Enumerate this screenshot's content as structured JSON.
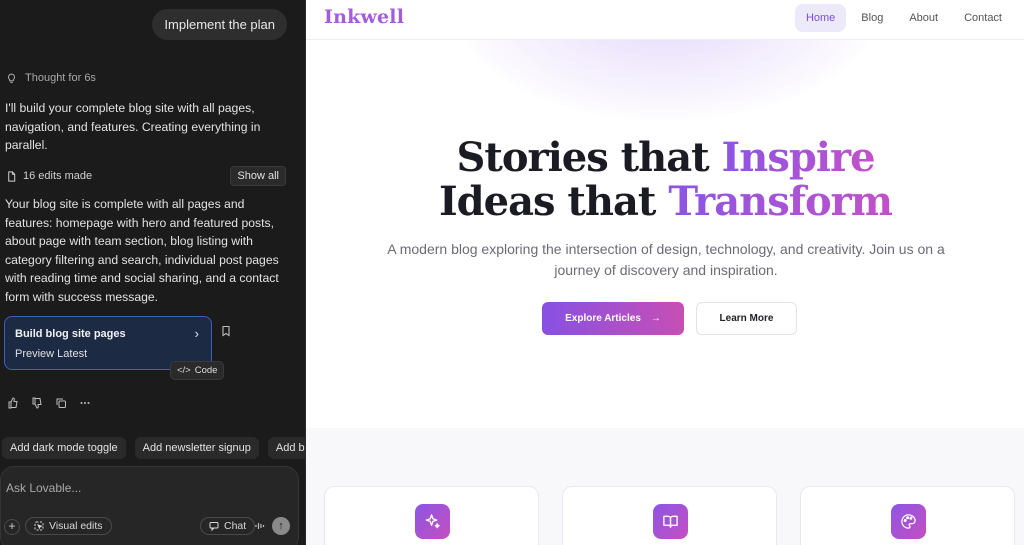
{
  "chat": {
    "user_message": "Implement the plan",
    "thought_label": "Thought for 6s",
    "intro_text": "I'll build your complete blog site with all pages, navigation, and features. Creating everything in parallel.",
    "edits_label": "16 edits made",
    "show_all_label": "Show all",
    "summary_text": "Your blog site is complete with all pages and features: homepage with hero and featured posts, about page with team section, blog listing with category filtering and search, individual post pages with reading time and social sharing, and a contact form with success message.",
    "version_card": {
      "title": "Build blog site pages",
      "subtitle": "Preview Latest",
      "chevron": "›"
    },
    "code_tooltip": "Code",
    "suggestions": [
      "Add dark mode toggle",
      "Add newsletter signup",
      "Add blog"
    ],
    "composer": {
      "placeholder": "Ask Lovable...",
      "plus_label": "+",
      "visual_edits_label": "Visual edits",
      "chat_label": "Chat",
      "send_label": "↑"
    }
  },
  "preview": {
    "logo": "Inkwell",
    "nav": [
      "Home",
      "Blog",
      "About",
      "Contact"
    ],
    "active_nav": "Home",
    "hero": {
      "line1_plain": "Stories that ",
      "line1_accent": "Inspire",
      "line2_plain": "Ideas that ",
      "line2_accent": "Transform",
      "subtitle": "A modern blog exploring the intersection of design, technology, and creativity. Join us on a journey of discovery and inspiration.",
      "primary_cta": "Explore Articles",
      "primary_cta_arrow": "→",
      "secondary_cta": "Learn More"
    },
    "feature_icons": [
      "sparkles-icon",
      "book-open-icon",
      "palette-icon"
    ]
  },
  "colors": {
    "chat_bg": "#1b1b1b",
    "brand_purple": "#a55be0",
    "gradient_start": "#8750e3",
    "gradient_end": "#c74fb4",
    "card_border_blue": "#3a5fbf"
  }
}
